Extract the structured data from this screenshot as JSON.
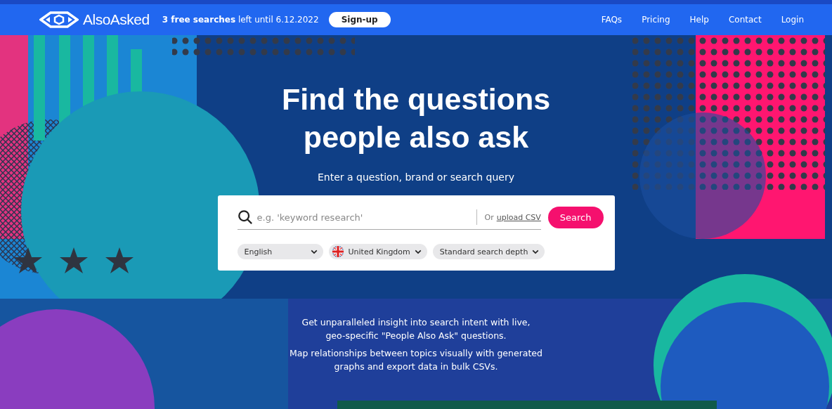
{
  "brand": {
    "name": "AlsoAsked"
  },
  "banner": {
    "text": "**3 free searches** left until 6.12.2022",
    "button": "Sign-up"
  },
  "nav": [
    "FAQs",
    "Pricing",
    "Help",
    "Contact",
    "Login"
  ],
  "hero": {
    "title_lines": [
      "Find the questions",
      "people also ask"
    ],
    "subtitle": "Enter a question, brand or search query"
  },
  "search": {
    "placeholder": "e.g. 'keyword research'",
    "upload_prefix": "Or",
    "upload_link": "upload CSV",
    "button": "Search",
    "dropdowns": [
      {
        "kind": "plain",
        "label": "English"
      },
      {
        "kind": "flag",
        "label": "United Kingdom"
      },
      {
        "kind": "plain",
        "label": "Standard search depth"
      }
    ]
  },
  "description": [
    "Get unparalleled insight into search intent with live, geo-specific \"People Also Ask\" questions.",
    "Map relationships between topics visually with generated graphs and export data in bulk CSVs."
  ]
}
